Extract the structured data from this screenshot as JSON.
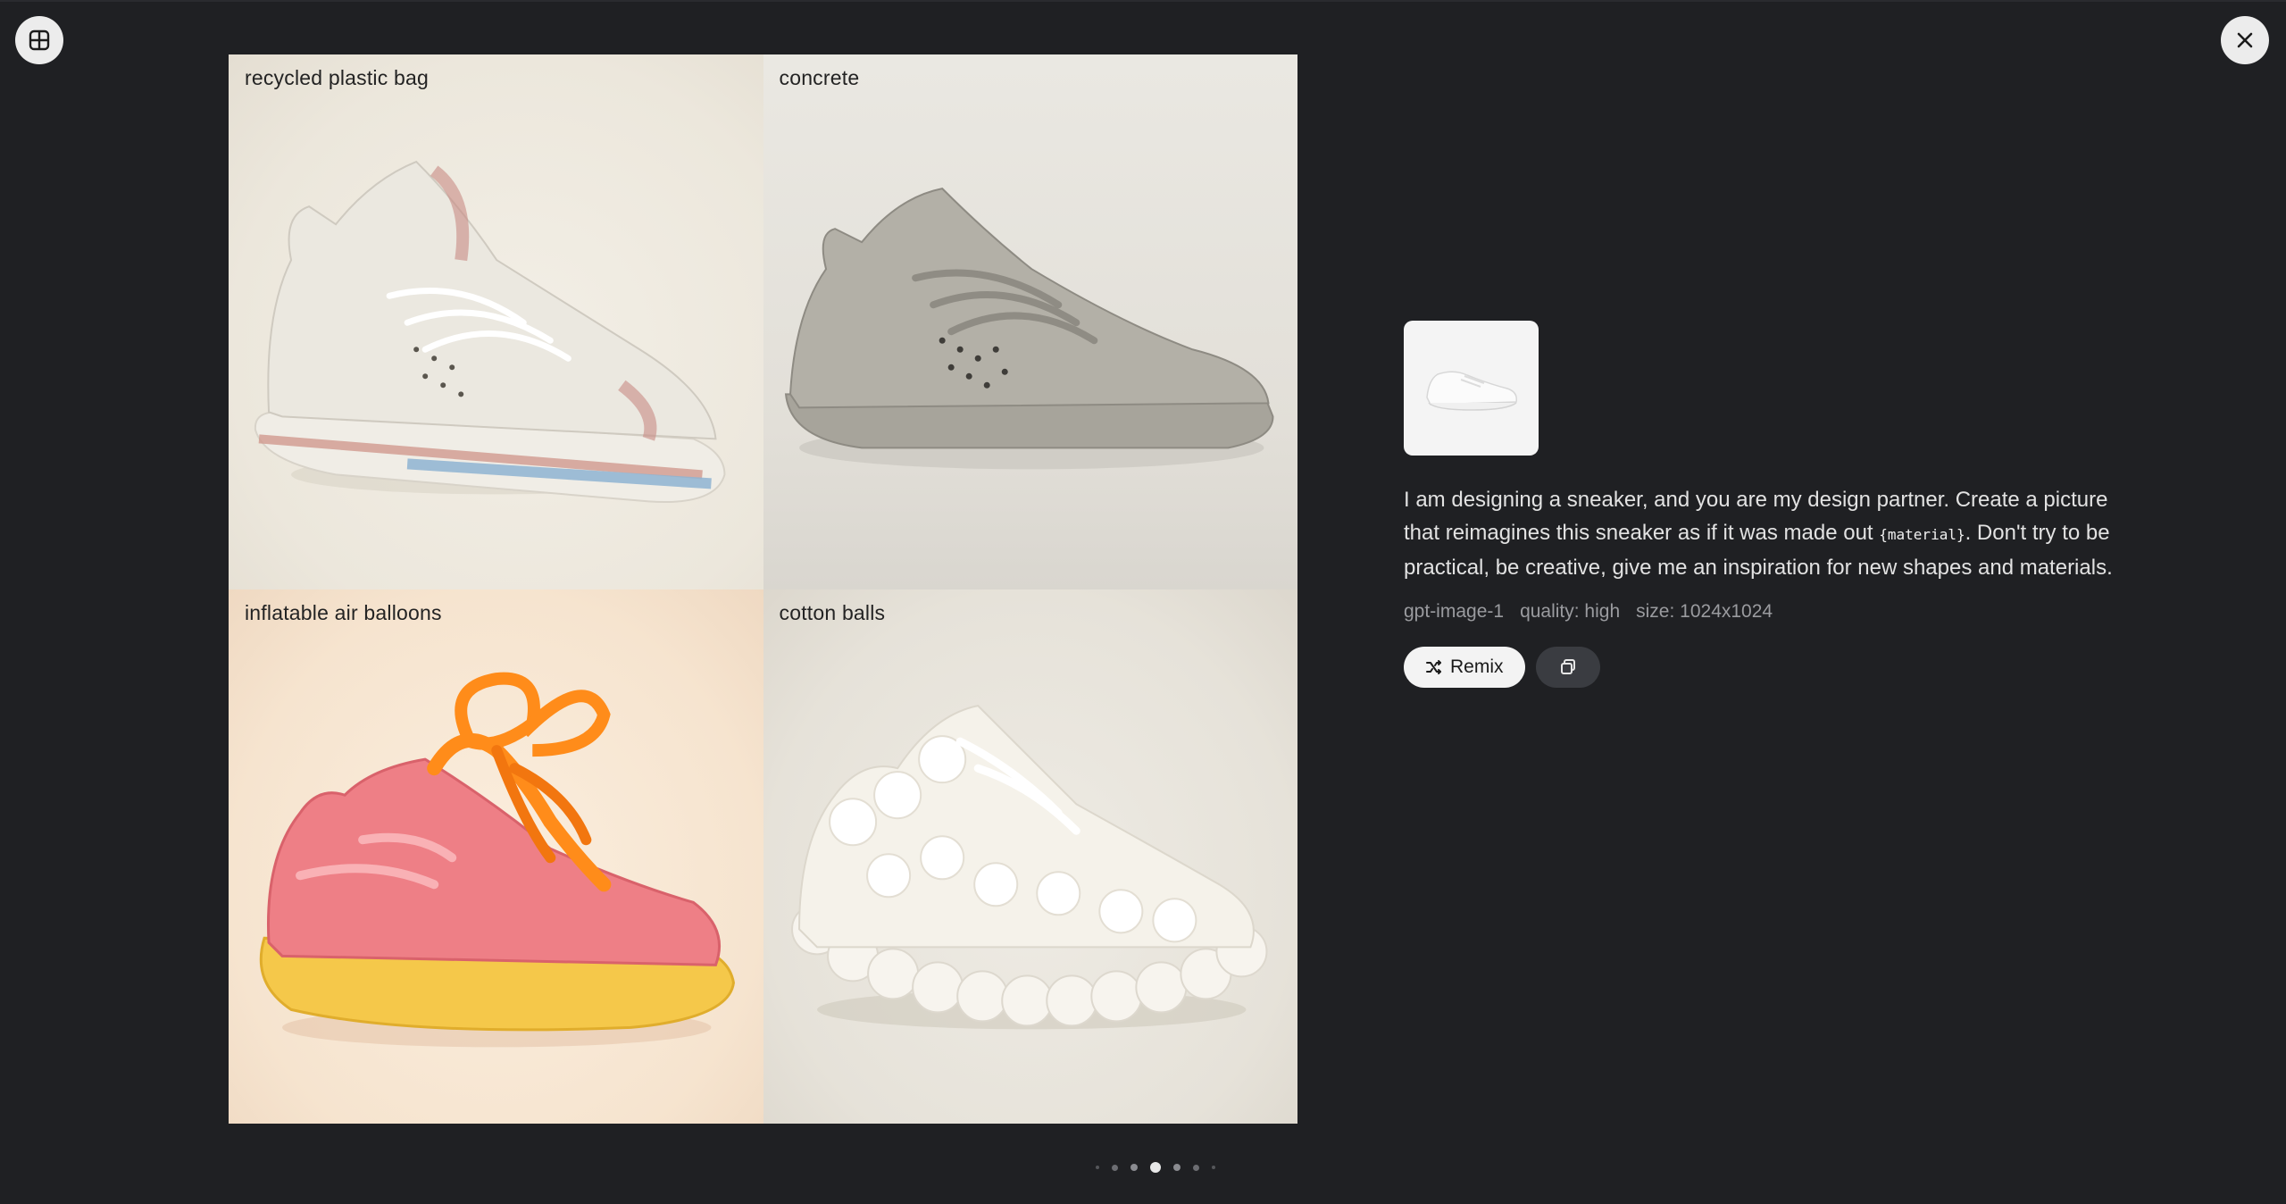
{
  "toolbar": {
    "grid_icon": "grid-icon",
    "close_icon": "close-icon"
  },
  "gallery": {
    "tiles": [
      {
        "label": "recycled plastic bag"
      },
      {
        "label": "concrete"
      },
      {
        "label": "inflatable air balloons"
      },
      {
        "label": "cotton balls"
      }
    ]
  },
  "details": {
    "prompt_part1": "I am designing a sneaker, and you are my design partner. Create a picture that reimagines this sneaker as if it was made out ",
    "prompt_variable": "{material}",
    "prompt_part2": ". Don't try to be practical, be creative, give me an inspiration for new shapes and materials.",
    "model": "gpt-image-1",
    "quality": "quality: high",
    "size": "size: 1024x1024",
    "remix_label": "Remix",
    "copy_icon": "copy-icon"
  },
  "pagination": {
    "count": 7,
    "active_index": 3
  }
}
